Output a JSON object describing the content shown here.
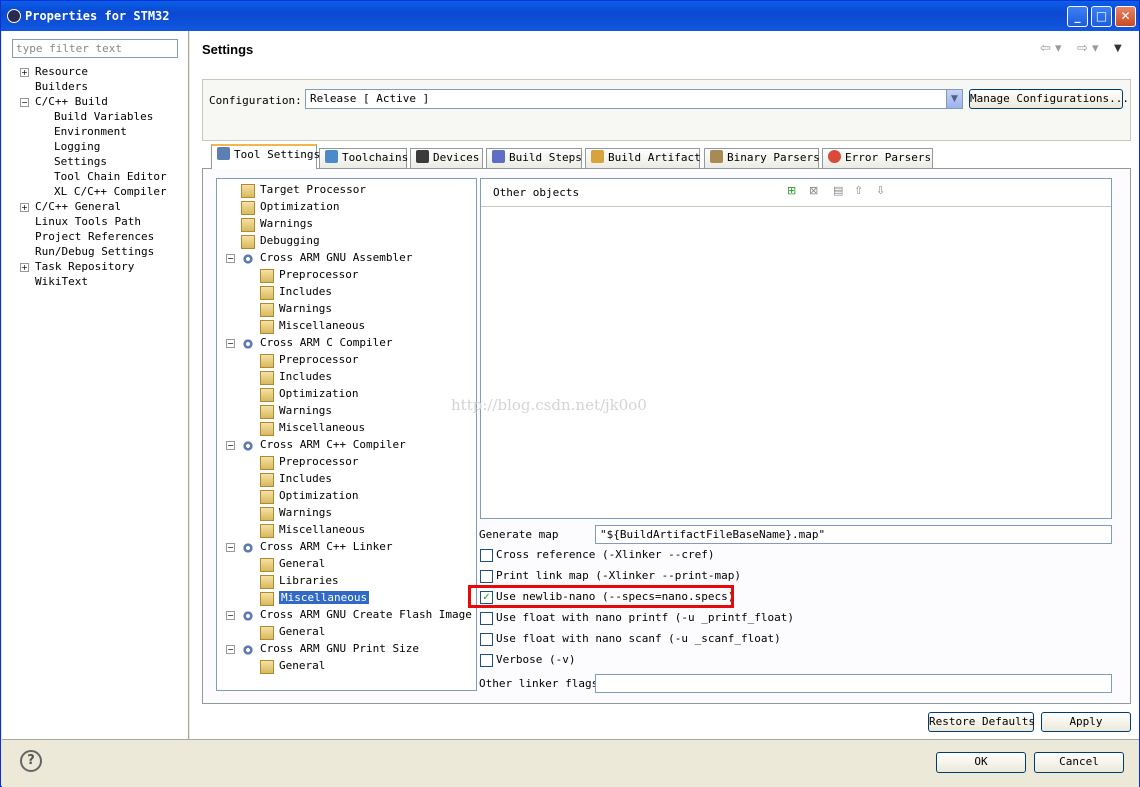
{
  "window": {
    "title": "Properties for STM32"
  },
  "filter": {
    "placeholder": "type filter text"
  },
  "nav": {
    "items": [
      "Resource",
      "Builders",
      "C/C++ Build",
      "Build Variables",
      "Environment",
      "Logging",
      "Settings",
      "Tool Chain Editor",
      "XL C/C++ Compiler",
      "C/C++ General",
      "Linux Tools Path",
      "Project References",
      "Run/Debug Settings",
      "Task Repository",
      "WikiText"
    ]
  },
  "page": {
    "title": "Settings"
  },
  "configuration": {
    "label": "Configuration:",
    "value": "Release  [ Active ]",
    "manage_label": "Manage Configurations..."
  },
  "tabs": [
    "Tool Settings",
    "Toolchains",
    "Devices",
    "Build Steps",
    "Build Artifact",
    "Binary Parsers",
    "Error Parsers"
  ],
  "tree": [
    "Target Processor",
    "Optimization",
    "Warnings",
    "Debugging",
    "Cross ARM GNU Assembler",
    "Preprocessor",
    "Includes",
    "Warnings",
    "Miscellaneous",
    "Cross ARM C Compiler",
    "Preprocessor",
    "Includes",
    "Optimization",
    "Warnings",
    "Miscellaneous",
    "Cross ARM C++ Compiler",
    "Preprocessor",
    "Includes",
    "Optimization",
    "Warnings",
    "Miscellaneous",
    "Cross ARM C++ Linker",
    "General",
    "Libraries",
    "Miscellaneous",
    "Cross ARM GNU Create Flash Image",
    "General",
    "Cross ARM GNU Print Size",
    "General"
  ],
  "objects": {
    "title": "Other objects"
  },
  "linker": {
    "generate_map_label": "Generate map",
    "generate_map_value": "\"${BuildArtifactFileBaseName}.map\"",
    "checks": [
      {
        "label": "Cross reference (-Xlinker --cref)",
        "checked": false
      },
      {
        "label": "Print link map (-Xlinker --print-map)",
        "checked": false
      },
      {
        "label": "Use newlib-nano (--specs=nano.specs)",
        "checked": true
      },
      {
        "label": "Use float with nano printf (-u _printf_float)",
        "checked": false
      },
      {
        "label": "Use float with nano scanf (-u _scanf_float)",
        "checked": false
      },
      {
        "label": "Verbose (-v)",
        "checked": false
      }
    ],
    "other_flags_label": "Other linker flags",
    "other_flags_value": ""
  },
  "watermark": "http://blog.csdn.net/jk0o0",
  "buttons": {
    "restore": "Restore Defaults",
    "apply": "Apply",
    "ok": "OK",
    "cancel": "Cancel",
    "help": "?"
  },
  "colors": {
    "title_bar": "#0a5fe8",
    "selection": "#316ac5",
    "highlight_box": "#e8090b"
  }
}
